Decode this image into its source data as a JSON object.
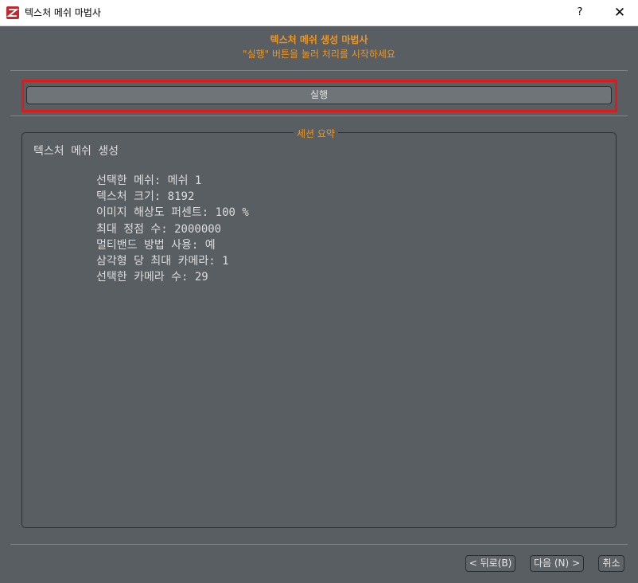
{
  "window": {
    "title": "텍스처 메쉬 마법사",
    "help_label": "?",
    "close_label": "✕"
  },
  "header": {
    "title": "텍스처 메쉬 생성 마법사",
    "subtitle": "\"실행\" 버튼을 눌러 처리를 시작하세요"
  },
  "run_button": {
    "label": "실행"
  },
  "summary": {
    "legend": "세션 요약",
    "heading": "텍스처 메쉬 생성",
    "lines": [
      "선택한 메쉬: 메쉬 1",
      "텍스처 크기: 8192",
      "이미지 해상도 퍼센트: 100 %",
      "최대 정점 수: 2000000",
      "멀티밴드 방법 사용: 예",
      "삼각형 당 최대 카메라: 1",
      "선택한 카메라 수: 29"
    ]
  },
  "footer": {
    "back_label": "< 뒤로(B)",
    "next_label": "다음 (N) >",
    "cancel_label": "취소"
  },
  "colors": {
    "accent": "#f0961e",
    "background": "#595e62",
    "highlight": "#e01a1a"
  }
}
